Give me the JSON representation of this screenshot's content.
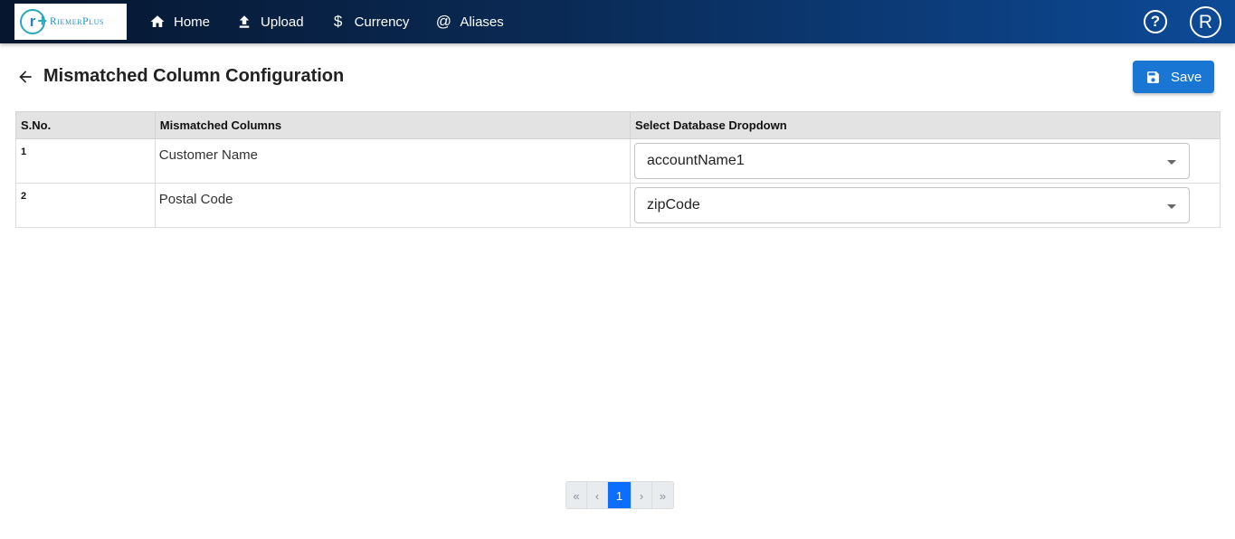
{
  "brand": {
    "name": "RiemerPlus",
    "mark": "r"
  },
  "nav": {
    "items": [
      {
        "label": "Home",
        "icon": "home-icon"
      },
      {
        "label": "Upload",
        "icon": "upload-icon"
      },
      {
        "label": "Currency",
        "icon": "dollar-icon"
      },
      {
        "label": "Aliases",
        "icon": "at-icon"
      }
    ],
    "help": "?",
    "avatar": "R"
  },
  "header": {
    "title": "Mismatched Column Configuration",
    "save_label": "Save"
  },
  "table": {
    "columns": [
      "S.No.",
      "Mismatched Columns",
      "Select Database Dropdown"
    ],
    "rows": [
      {
        "sno": "1",
        "column": "Customer Name",
        "selected": "accountName1"
      },
      {
        "sno": "2",
        "column": "Postal Code",
        "selected": "zipCode"
      }
    ]
  },
  "pagination": {
    "first": "«",
    "prev": "‹",
    "current": "1",
    "next": "›",
    "last": "»"
  },
  "colors": {
    "accent": "#1976d2",
    "active_page": "#0d6efd",
    "header_bg": "#e3e3e3"
  }
}
